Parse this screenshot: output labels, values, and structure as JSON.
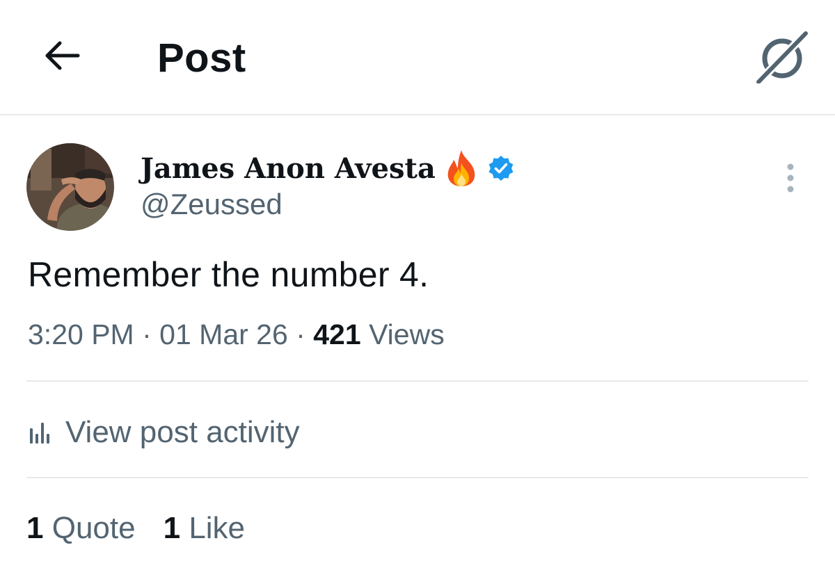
{
  "header": {
    "title": "Post",
    "back_icon": "arrow-left-icon",
    "grok_icon": "grok-icon"
  },
  "author": {
    "display_name": "James Anon Avesta",
    "emoji": "🔥",
    "verified": true,
    "verified_color": "#1d9bf0",
    "handle": "@Zeussed"
  },
  "post": {
    "text": "Remember the number 4.",
    "time": "3:20 PM",
    "date": "01 Mar 26",
    "separator": "·",
    "views_count": "421",
    "views_label": "Views"
  },
  "activity": {
    "label": "View post activity",
    "icon": "bar-chart-icon"
  },
  "stats": {
    "quotes_count": "1",
    "quotes_label": "Quote",
    "likes_count": "1",
    "likes_label": "Like"
  },
  "colors": {
    "primary_text": "#0f1419",
    "secondary_text": "#536471",
    "divider": "#e7e9ea",
    "accent": "#1d9bf0"
  }
}
